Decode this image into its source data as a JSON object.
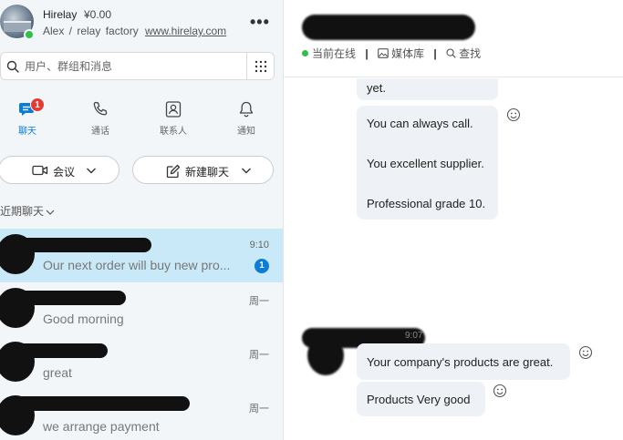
{
  "profile": {
    "name": "Hirelay",
    "balance": "¥0.00",
    "subtitle": "Alex /  relay  factory",
    "link": "www.hirelay.com",
    "more_label": "•••",
    "status_color": "#2fbf4b"
  },
  "search": {
    "placeholder": "用户、群组和消息",
    "icon": "search-icon",
    "dialpad_icon": "dialpad-icon"
  },
  "nav": {
    "tabs": [
      {
        "label": "聊天",
        "icon": "chat-icon",
        "badge": "1",
        "active": true
      },
      {
        "label": "通话",
        "icon": "phone-icon"
      },
      {
        "label": "联系人",
        "icon": "contacts-icon"
      },
      {
        "label": "通知",
        "icon": "bell-icon"
      }
    ]
  },
  "actions": {
    "meeting": "会议",
    "new_chat": "新建聊天"
  },
  "recent": {
    "header": "近期聊天"
  },
  "chats": [
    {
      "time": "9:10",
      "preview": "Our next order will buy new pro...",
      "unread": "1",
      "active": true
    },
    {
      "time": "周一",
      "preview": "Good morning"
    },
    {
      "time": "周一",
      "preview": "great"
    },
    {
      "time": "周一",
      "preview": "we arrange payment"
    }
  ],
  "chat_header": {
    "status": "当前在线",
    "media": "媒体库",
    "find": "查找",
    "separator": "|"
  },
  "messages": {
    "cut_top": "yet.",
    "group1": [
      "You can always call.",
      "You excellent supplier.",
      "Professional grade 10."
    ],
    "time": "9:07",
    "group2": [
      "Your company's products are great.",
      "Products Very good"
    ]
  },
  "colors": {
    "accent": "#0a7ed6",
    "badge_red": "#e53935",
    "active_row": "#c9e9f8",
    "bubble": "#eef1f5"
  }
}
